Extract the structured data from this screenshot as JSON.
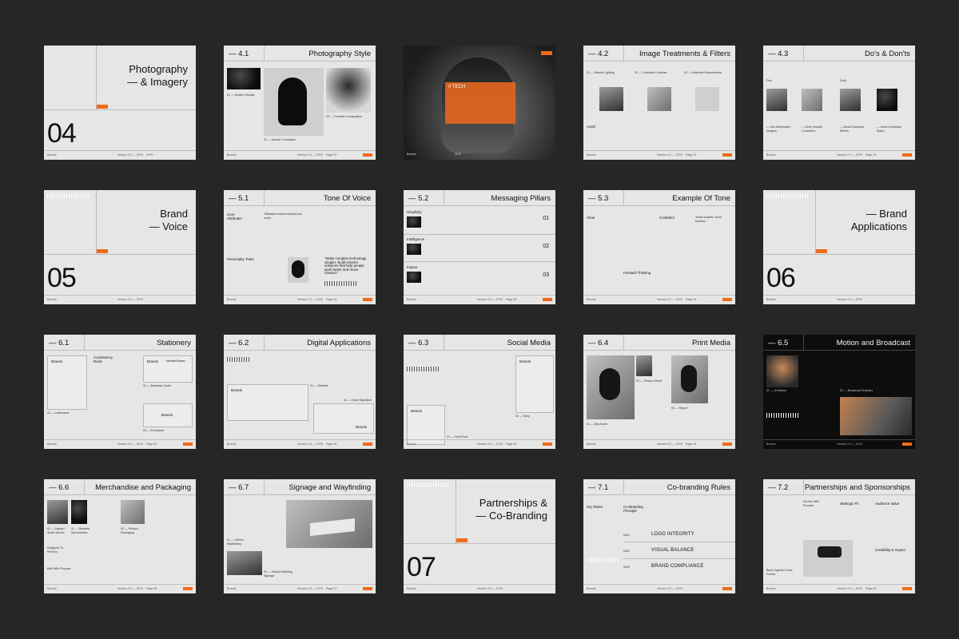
{
  "footer": {
    "brand": "Brando",
    "version": "Version 2.0 — 2078"
  },
  "slides": {
    "s1": {
      "title": "Photography\n— & Imagery",
      "number": "04",
      "tag": "Brand",
      "f3": "2078"
    },
    "s2": {
      "num": "— 4.1",
      "title": "Photography Style",
      "c1": "01 — Modern Visuals",
      "c2": "02 — Human Connection",
      "c3": "03 — Futuristic Composition",
      "page": "Page 20"
    },
    "s3": {
      "badge": "// TECH",
      "tag": "Brand",
      "f1": "Brando",
      "f2": "2078"
    },
    "s4": {
      "num": "— 4.2",
      "title": "Image Treatments & Filters",
      "h1": "01 — Natural Lighting",
      "h2": "02 — Controlled Contrast",
      "h3": "03 — Authentic Environments",
      "avoid": "Avoid",
      "page": "Page 22"
    },
    "s5": {
      "num": "— 4.3",
      "title": "Do's & Don'ts",
      "do": "Do's",
      "dont": "Don't",
      "c1": "— Use Meaningful Imagery",
      "c2": "— Keep Visuals Consistent",
      "c3": "— Avoid Excessive Effects",
      "c4": "— Avoid Unrealistic Styles",
      "page": "Page 23"
    },
    "s6": {
      "title": "Brand\n— Voice",
      "number": "05",
      "tag": "Brand"
    },
    "s7": {
      "num": "— 5.1",
      "title": "Tone Of Voice",
      "core": "Core Attributes",
      "traits": "Personality Traits",
      "quote": "\"Make complex technology simpler. Build smarter solutions that help people work better and move forward.\"",
      "page": "Page 25"
    },
    "s8": {
      "num": "— 5.2",
      "title": "Messaging Pillars",
      "p1": "Simplicity",
      "p2": "Intelligence",
      "p3": "Impact",
      "n1": "01",
      "n2": "02",
      "n3": "03",
      "page": "Page 26"
    },
    "s9": {
      "num": "— 5.3",
      "title": "Example Of Tone",
      "clear": "Clear",
      "confident": "Confident",
      "forward": "Forward-Thinking",
      "page": "Page 26"
    },
    "s10": {
      "title": "— Brand\nApplications",
      "number": "06",
      "tag": "Brand"
    },
    "s11": {
      "num": "— 6.1",
      "title": "Stationery",
      "rules": "Consistency Rules",
      "brand": "Brando",
      "name": "Michael Brown",
      "c1": "01 — Letterhead",
      "c2": "02 — Business Cards",
      "c3": "03 — Envelopes",
      "page": "Page 30"
    },
    "s12": {
      "num": "— 6.2",
      "title": "Digital Applications",
      "brand": "Brando",
      "c1": "01 — Website",
      "c2": "02 — Email Signature",
      "page": "Page 30"
    },
    "s13": {
      "num": "— 6.3",
      "title": "Social Media",
      "brand": "Brando",
      "c1": "01 — Feed Post",
      "c2": "02 — Story",
      "page": "Page 33"
    },
    "s14": {
      "num": "— 6.4",
      "title": "Print Media",
      "c1": "01 — Brochures",
      "c2": "02 — Product Sheet",
      "c3": "03 — Report",
      "page": "Page 34"
    },
    "s15": {
      "num": "— 6.5",
      "title": "Motion and Broadcast",
      "c1": "01 — UI Motion",
      "c2": "02 — Broadcast Graphics"
    },
    "s16": {
      "num": "— 6.6",
      "title": "Merchandise and Packaging",
      "c1": "01 — Laptop / Smart Device",
      "c2": "02 — Branded Merchandise",
      "c3": "03 — Product Packaging",
      "l1": "Designed To Perform",
      "l2": "Built With Purpose",
      "page": "Page 36"
    },
    "s17": {
      "num": "— 6.7",
      "title": "Signage and Wayfinding",
      "c1": "01 — Interior Wayfinding",
      "c2": "02 — Exterior Building Signage",
      "page": "Page 37"
    },
    "s18": {
      "title": "Partnerships &\n— Co-Branding",
      "number": "07",
      "tag": "Brand"
    },
    "s19": {
      "num": "— 7.1",
      "title": "Co-branding Rules",
      "key": "Key Rules",
      "principle": "Co-Branding Principle",
      "r1": "LOGO INTEGRITY",
      "r2": "VISUAL BALANCE",
      "r3": "BRAND COMPLIANCE",
      "n1": "0001",
      "n2": "0002",
      "n3": "0003"
    },
    "s20": {
      "num": "— 7.2",
      "title": "Partnerships and Sponsorships",
      "fit": "Strategic Fit",
      "vision": "Audience Value",
      "cred": "Credibility & Impact",
      "partner": "Partner With Purpose",
      "build": "Build Together Grow Further",
      "page": "Page 40"
    }
  }
}
